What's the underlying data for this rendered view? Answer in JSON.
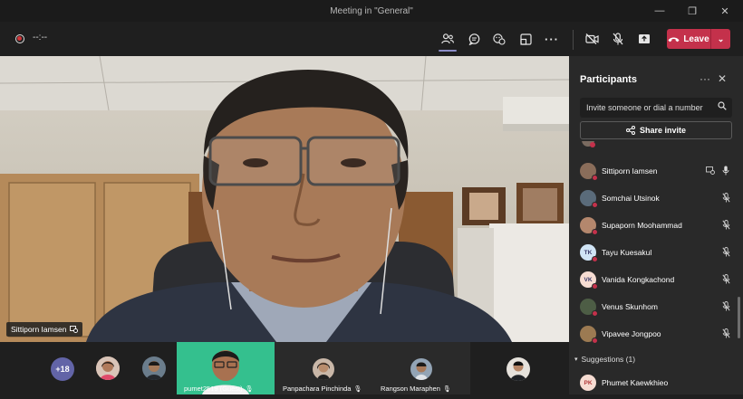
{
  "window": {
    "title": "Meeting in \"General\"",
    "controls": [
      "minimize-icon",
      "restore-icon",
      "close-icon"
    ]
  },
  "toolbar": {
    "timer": "--:--",
    "buttons": [
      "people-icon",
      "chat-icon",
      "reactions-icon",
      "rooms-icon",
      "more-icon",
      "camera-off-icon",
      "mic-off-icon",
      "share-icon"
    ],
    "leave_label": "Leave",
    "leave_color": "#c4314b"
  },
  "main_video": {
    "name": "Sittiporn Iamsen"
  },
  "strip": {
    "overflow_count": "+18",
    "tiles": [
      {
        "label": "pumet2519 (Guest)",
        "highlight": "#2bb587"
      },
      {
        "label": "Panpachara Pinchinda"
      },
      {
        "label": "Rangson Maraphen"
      }
    ]
  },
  "panel": {
    "title": "Participants",
    "invite_placeholder": "Invite someone or dial a number",
    "share_invite": "Share invite",
    "participants": [
      {
        "name": "Sittiporn Iamsen",
        "initials": "",
        "avatar_color": "#8a6d5a",
        "mic": "on",
        "sharing": true
      },
      {
        "name": "Somchai Utsinok",
        "initials": "",
        "avatar_color": "#5a6b7a",
        "mic": "off"
      },
      {
        "name": "Supaporn Moohammad",
        "initials": "",
        "avatar_color": "#b4876d",
        "mic": "off"
      },
      {
        "name": "Tayu Kuesakul",
        "initials": "TK",
        "avatar_color": "#d0e4f5",
        "mic": "off"
      },
      {
        "name": "Vanida Kongkachond",
        "initials": "VK",
        "avatar_color": "#f6dcd2",
        "mic": "off"
      },
      {
        "name": "Venus Skunhom",
        "initials": "",
        "avatar_color": "#4d5d45",
        "mic": "off"
      },
      {
        "name": "Vipavee Jongpoo",
        "initials": "",
        "avatar_color": "#9c7a52",
        "mic": "off"
      }
    ],
    "suggestions_label": "Suggestions (1)",
    "suggestions": [
      {
        "name": "Phumet Kaewkhieo",
        "initials": "PK",
        "avatar_color": "#f6dcd2"
      }
    ]
  }
}
